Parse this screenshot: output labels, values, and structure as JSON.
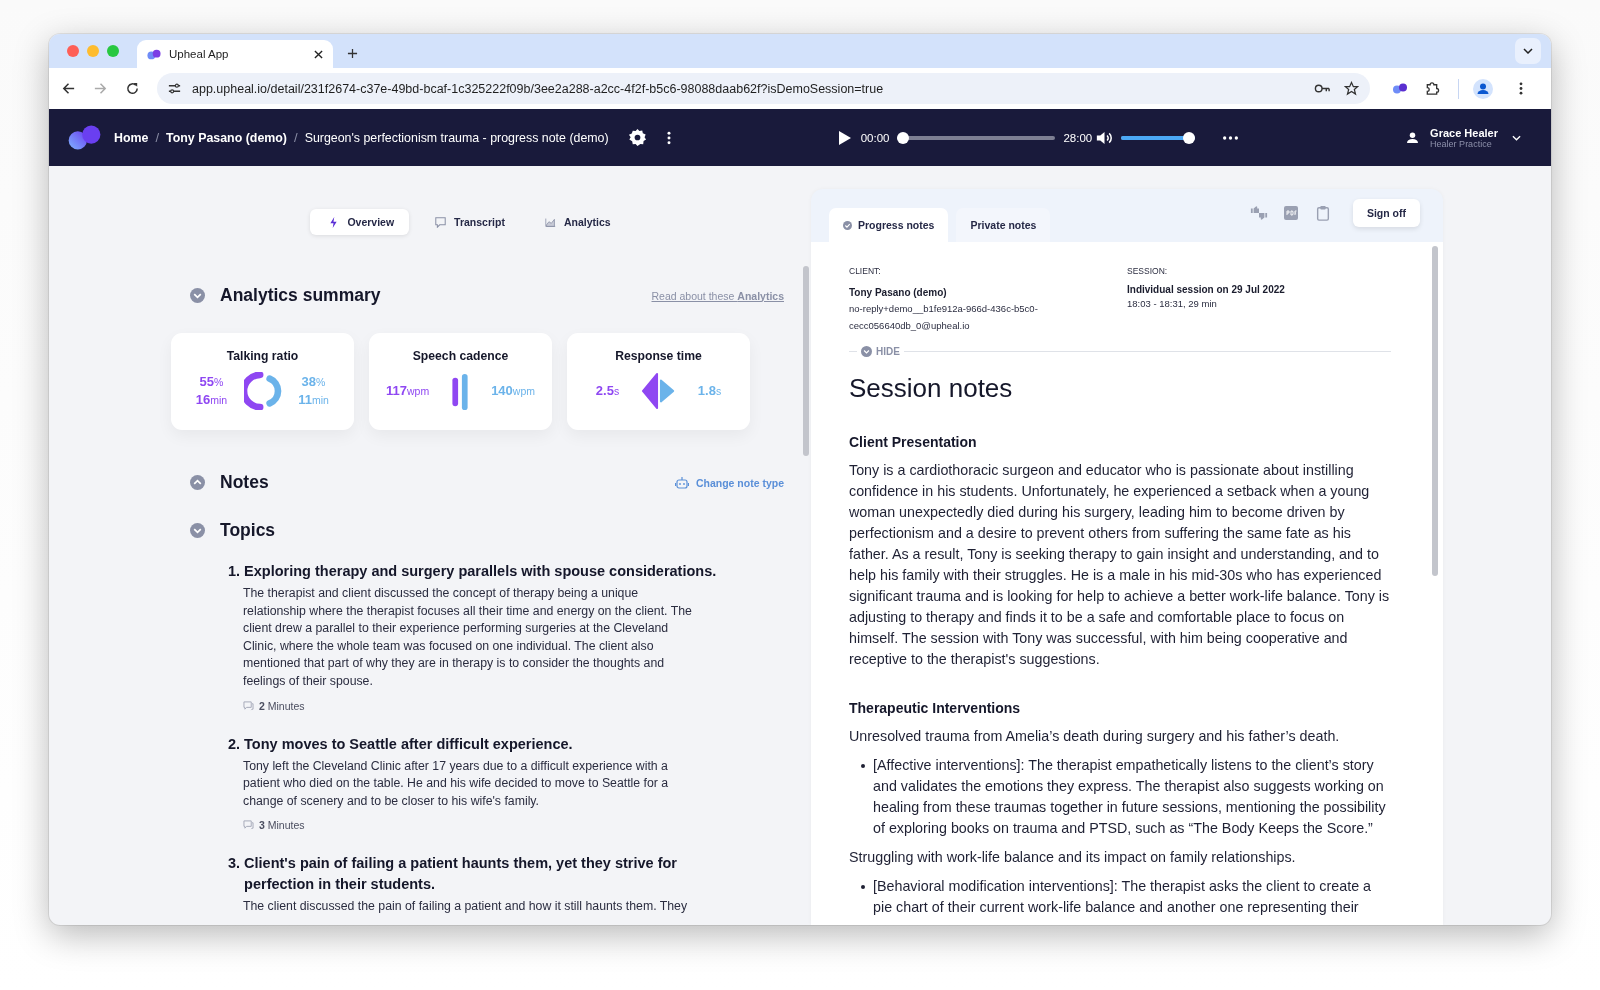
{
  "browser": {
    "tab_title": "Upheal App",
    "url": "app.upheal.io/detail/231f2674-c37e-49bd-bcaf-1c325222f09b/3ee2a288-a2cc-4f2f-b5c6-98088daab62f?isDemoSession=true"
  },
  "header": {
    "breadcrumbs": [
      {
        "label": "Home",
        "bold": true
      },
      {
        "label": "Tony Pasano (demo)",
        "bold": true
      },
      {
        "label": "Surgeon's perfectionism trauma - progress note (demo)",
        "bold": false
      }
    ],
    "separator": "/",
    "player": {
      "current_time": "00:00",
      "progress": {
        "level": 0
      },
      "total_time": "28:00",
      "volume": {
        "level": 1
      }
    },
    "user": {
      "name": "Grace Healer",
      "role": "Healer Practice"
    }
  },
  "view_tabs": [
    {
      "label": "Overview",
      "kind": "bolt",
      "selected": true
    },
    {
      "label": "Transcript",
      "kind": "chat",
      "selected": false
    },
    {
      "label": "Analytics",
      "kind": "chart",
      "selected": false
    }
  ],
  "analytics": {
    "title": "Analytics summary",
    "expanded": true,
    "link": "Read about these **Analytics**",
    "cards": [
      {
        "title": "Talking ratio",
        "kind": "ratio",
        "left": [
          {
            "value": "55",
            "unit": "%"
          },
          {
            "value": "16",
            "unit": "min"
          }
        ],
        "right": [
          {
            "value": "38",
            "unit": "%"
          },
          {
            "value": "11",
            "unit": "min"
          }
        ]
      },
      {
        "title": "Speech cadence",
        "kind": "cadence",
        "left": [
          {
            "value": "117",
            "unit": "wpm"
          }
        ],
        "right": [
          {
            "value": "140",
            "unit": "wpm"
          }
        ]
      },
      {
        "title": "Response time",
        "kind": "response",
        "left": [
          {
            "value": "2.5",
            "unit": "s"
          }
        ],
        "right": [
          {
            "value": "1.8",
            "unit": "s"
          }
        ]
      }
    ]
  },
  "notes": {
    "title": "Notes",
    "expanded": false,
    "action": "Change note type"
  },
  "topics": {
    "title": "Topics",
    "expanded": true,
    "items": [
      {
        "number": "1.",
        "title": "Exploring therapy and surgery parallels with spouse considerations.",
        "body": "The therapist and client discussed the concept of therapy being a unique relationship where the therapist focuses all their time and energy on the client. The client drew a parallel to their experience performing surgeries at the Cleveland Clinic, where the whole team was focused on one individual. The client also mentioned that part of why they are in therapy is to consider the thoughts and feelings of their spouse.",
        "duration": "**2** Minutes"
      },
      {
        "number": "2.",
        "title": "Tony moves to Seattle after difficult experience.",
        "body": "Tony left the Cleveland Clinic after 17 years due to a difficult experience with a patient who died on the table. He and his wife decided to move to Seattle for a change of scenery and to be closer to his wife's family.",
        "duration": "**3** Minutes"
      },
      {
        "number": "3.",
        "title": "Client's pain of failing a patient haunts them, yet they strive for perfection in their students.",
        "body": "The client discussed the pain of failing a patient and how it still haunts them. They"
      }
    ]
  },
  "note_tabs": [
    {
      "label": "Progress notes",
      "selected": true
    },
    {
      "label": "Private notes",
      "selected": false
    }
  ],
  "sign_off": "Sign off",
  "client": {
    "label": "CLIENT:",
    "name": "Tony Pasano (demo)",
    "email": "no-reply+demo__b1fe912a-966d-436c-b5c0-cecc056640db_0@upheal.io"
  },
  "session": {
    "label": "SESSION:",
    "title": "Individual session on 29 Jul 2022",
    "time": "18:03 - 18:31, 29 min"
  },
  "hide": "HIDE",
  "session_notes": {
    "title": "Session notes",
    "sections": [
      {
        "heading": "Client Presentation",
        "blocks": [
          {
            "kind": "paragraph",
            "text": "Tony is a cardiothoracic surgeon and educator who is passionate about instilling confidence in his students. Unfortunately, he experienced a setback when a young woman unexpectedly died during his surgery, leading him to become driven by perfectionism and a desire to prevent others from suffering the same fate as his father. As a result, Tony is seeking therapy to gain insight and understanding, and to help his family with their struggles. He is a male in his mid-30s who has experienced significant trauma and is looking for help to achieve a better work-life balance. Tony is adjusting to therapy and finds it to be a safe and comfortable place to focus on himself. The session with Tony was successful, with him being cooperative and receptive to the therapist's suggestions."
          }
        ]
      },
      {
        "heading": "Therapeutic Interventions",
        "blocks": [
          {
            "kind": "paragraph",
            "text": "Unresolved trauma from Amelia’s death during surgery and his father’s death."
          },
          {
            "kind": "bullet",
            "text": "[Affective interventions]: The therapist empathetically listens to the client’s story and validates the emotions they express. The therapist also suggests working on healing from these traumas together in future sessions, mentioning the possibility of exploring books on trauma and PTSD, such as “The Body Keeps the Score.”"
          },
          {
            "kind": "paragraph",
            "text": "Struggling with work-life balance and its impact on family relationships."
          },
          {
            "kind": "bullet",
            "text": "[Behavioral modification interventions]: The therapist asks the client to create a pie chart of their current work-life balance and another one representing their"
          }
        ]
      }
    ]
  }
}
